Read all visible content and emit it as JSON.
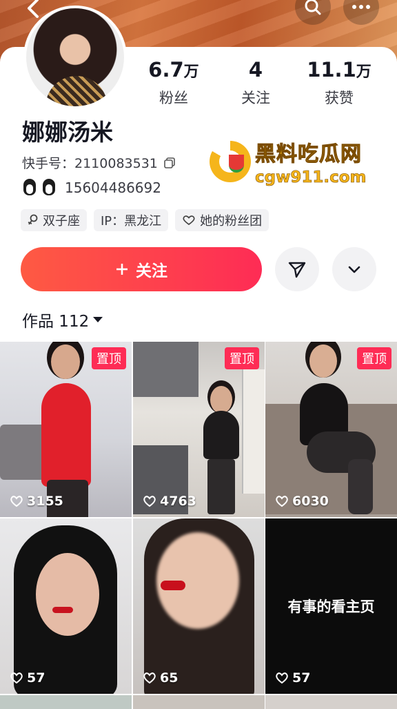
{
  "profile": {
    "name": "娜娜汤米",
    "kuaishou_id": "快手号：2110083531",
    "qq_number": "15604486692",
    "stats": [
      {
        "value": "6.7",
        "unit": "万",
        "label": "粉丝"
      },
      {
        "value": "4",
        "unit": "",
        "label": "关注"
      },
      {
        "value": "11.1",
        "unit": "万",
        "label": "获赞"
      }
    ],
    "tags": [
      {
        "icon": "female-icon",
        "label": "双子座"
      },
      {
        "icon": "",
        "label": "IP：黑龙江"
      },
      {
        "icon": "heart-outline-icon",
        "label": "她的粉丝团"
      }
    ]
  },
  "actions": {
    "follow_label": "关注",
    "follow_icon": "plus-icon",
    "share_icon": "send-icon",
    "more_icon": "chevron-down-icon"
  },
  "header": {
    "back_icon": "back-arrow-icon",
    "search_icon": "search-icon",
    "menu_icon": "more-dots-icon"
  },
  "watermark": {
    "name": "黑料吃瓜网",
    "url": "cgw911.com"
  },
  "works": {
    "label": "作品 112",
    "items": [
      {
        "pinned": true,
        "pin_label": "置顶",
        "likes": "3155"
      },
      {
        "pinned": true,
        "pin_label": "置顶",
        "likes": "4763"
      },
      {
        "pinned": true,
        "pin_label": "置顶",
        "likes": "6030"
      },
      {
        "pinned": false,
        "likes": "57"
      },
      {
        "pinned": false,
        "likes": "65"
      },
      {
        "pinned": false,
        "likes": "57",
        "text": "有事的看主页"
      }
    ]
  },
  "colors": {
    "accent": "#fe2c55",
    "follow_gradient_start": "#fe5a43",
    "watermark": "#f5b51b"
  }
}
